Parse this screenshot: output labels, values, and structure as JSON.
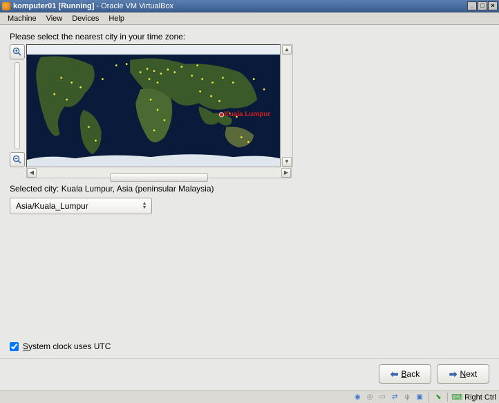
{
  "vbox": {
    "vm_name": "komputer01",
    "vm_state": "Running",
    "app_name": "Oracle VM VirtualBox",
    "menu": {
      "machine": "Machine",
      "view": "View",
      "devices": "Devices",
      "help": "Help"
    },
    "status_hostkey": "Right Ctrl"
  },
  "installer": {
    "prompt": "Please select the nearest city in your time zone:",
    "selected_city_prefix": "Selected city:",
    "selected_city_value": "Kuala Lumpur, Asia (peninsular Malaysia)",
    "timezone_value": "Asia/Kuala_Lumpur",
    "map_marker_label": "Kuala Lumpur",
    "utc_checkbox_label_pre": "",
    "utc_checkbox_ul": "S",
    "utc_checkbox_label_post": "ystem clock uses UTC",
    "utc_checked": true,
    "back_pre": "",
    "back_ul": "B",
    "back_post": "ack",
    "next_pre": "",
    "next_ul": "N",
    "next_post": "ext"
  },
  "icons": {
    "zoom_in": "zoom-in-icon",
    "zoom_out": "zoom-out-icon"
  }
}
